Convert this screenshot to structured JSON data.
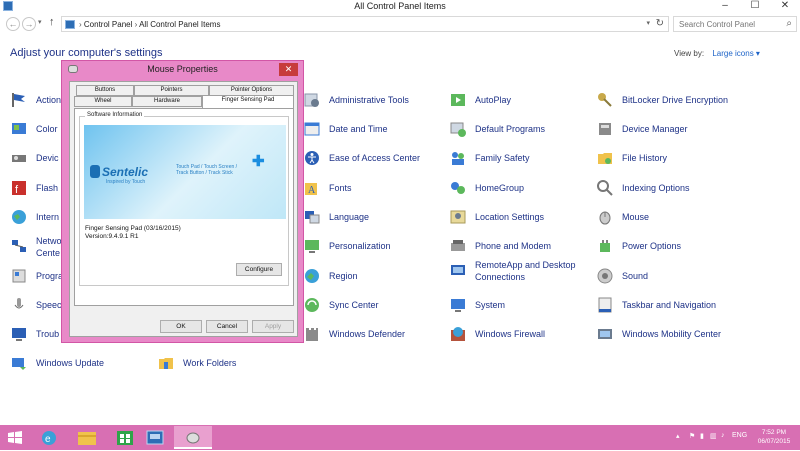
{
  "window": {
    "title": "All Control Panel Items",
    "controls": [
      "–",
      "☐",
      "✕"
    ]
  },
  "address": {
    "crumbs": [
      "Control Panel",
      "All Control Panel Items"
    ],
    "search_placeholder": "Search Control Panel"
  },
  "heading": "Adjust your computer's settings",
  "view_by": {
    "label": "View by:",
    "value": "Large icons"
  },
  "items": [
    {
      "label": "Action"
    },
    {
      "label": "Color"
    },
    {
      "label": "Devic"
    },
    {
      "label": "Flash"
    },
    {
      "label": "Intern"
    },
    {
      "label": "Netwo\nCente"
    },
    {
      "label": "Progra"
    },
    {
      "label": "Speec"
    },
    {
      "label": "Troub"
    },
    {
      "label": "Windows Update"
    },
    {
      "label": "Work Folders"
    },
    {
      "label": "Administrative Tools"
    },
    {
      "label": "Date and Time"
    },
    {
      "label": "Ease of Access Center"
    },
    {
      "label": "Fonts"
    },
    {
      "label": "Language"
    },
    {
      "label": "Personalization"
    },
    {
      "label": "Region"
    },
    {
      "label": "Sync Center"
    },
    {
      "label": "Windows Defender"
    },
    {
      "label": "AutoPlay"
    },
    {
      "label": "Default Programs"
    },
    {
      "label": "Family Safety"
    },
    {
      "label": "HomeGroup"
    },
    {
      "label": "Location Settings"
    },
    {
      "label": "Phone and Modem"
    },
    {
      "label": "RemoteApp and Desktop Connections"
    },
    {
      "label": "System"
    },
    {
      "label": "Windows Firewall"
    },
    {
      "label": "BitLocker Drive Encryption"
    },
    {
      "label": "Device Manager"
    },
    {
      "label": "File History"
    },
    {
      "label": "Indexing Options"
    },
    {
      "label": "Mouse"
    },
    {
      "label": "Power Options"
    },
    {
      "label": "Sound"
    },
    {
      "label": "Taskbar and Navigation"
    },
    {
      "label": "Windows Mobility Center"
    }
  ],
  "dialog": {
    "title": "Mouse Properties",
    "close": "✕",
    "tabs": [
      "Buttons",
      "Pointers",
      "Pointer Options",
      "Wheel",
      "Hardware",
      "Finger Sensing Pad"
    ],
    "group_label": "Software Information",
    "logo": "Sentelic",
    "logo_tag": "Inspired by Touch",
    "logo_products": "Touch Pad / Touch Screen /\nTrack Button / Track Stick",
    "info_line1": "Finger Sensing Pad (03/16/2015)",
    "info_line2": "Version:9.4.9.1 R1",
    "configure": "Configure",
    "ok": "OK",
    "cancel": "Cancel",
    "apply": "Apply"
  },
  "taskbar": {
    "lang": "ENG",
    "time": "7:52 PM",
    "date": "06/07/2015"
  },
  "colors": {
    "accent": "#d86fb3",
    "link": "#1e3287",
    "dialog_frame": "#e889c8"
  }
}
